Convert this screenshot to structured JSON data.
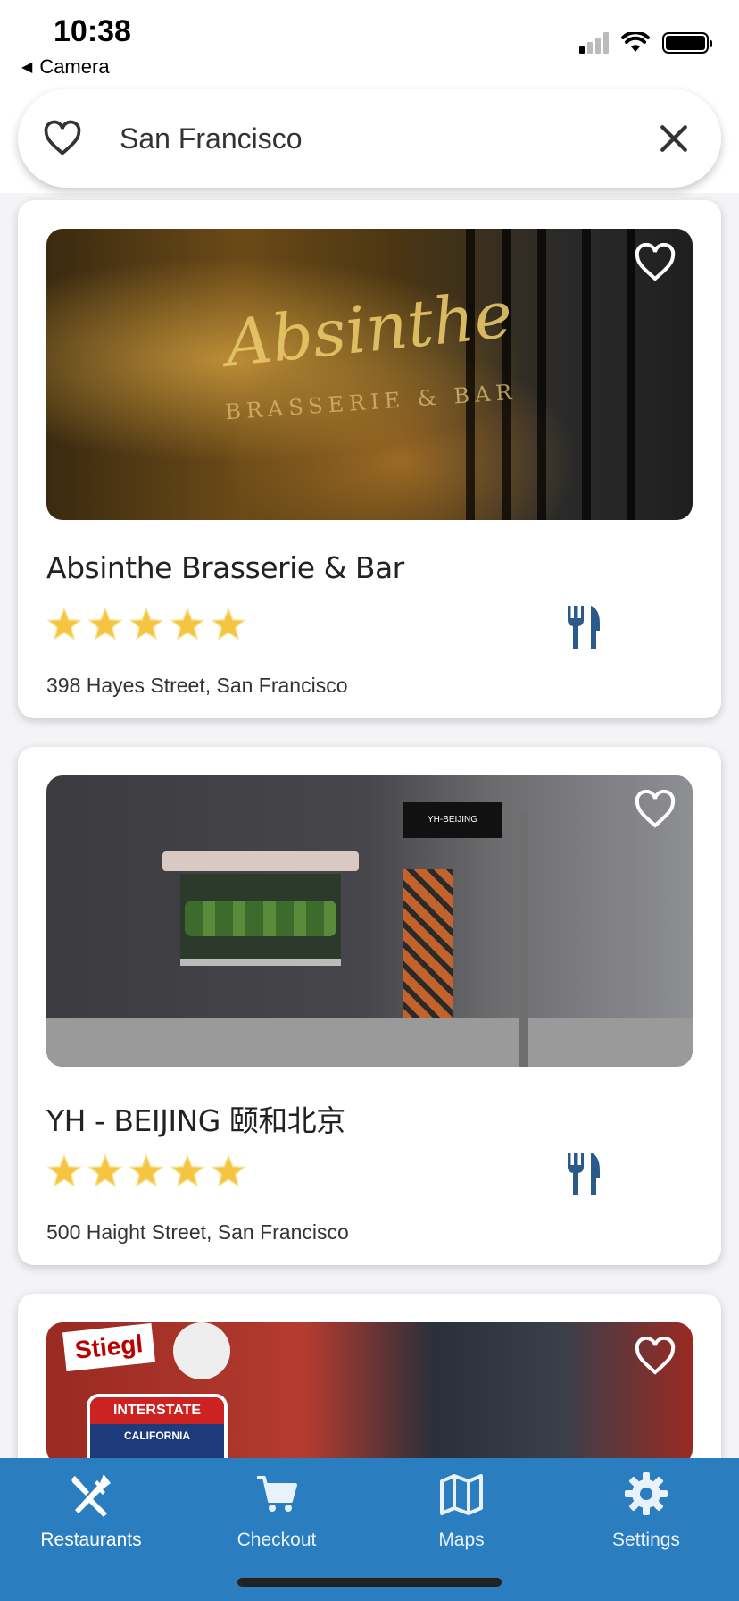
{
  "status_bar": {
    "time": "10:38",
    "back_label": "Camera"
  },
  "search": {
    "value": "San Francisco"
  },
  "restaurants": [
    {
      "name": "Absinthe Brasserie & Bar",
      "address": "398 Hayes Street, San Francisco",
      "rating": 5,
      "photo_text": "Absinthe",
      "photo_subtext": "BRASSERIE & BAR"
    },
    {
      "name": "YH - BEIJING 颐和北京",
      "address": "500 Haight Street, San Francisco",
      "rating": 5,
      "photo_text": "YH-BEIJING"
    },
    {
      "photo_logo": "Stiegl",
      "photo_shield_top": "INTERSTATE",
      "photo_shield_bottom": "CALIFORNIA"
    }
  ],
  "tabs": [
    {
      "label": "Restaurants",
      "icon": "fork-knife-icon"
    },
    {
      "label": "Checkout",
      "icon": "cart-icon"
    },
    {
      "label": "Maps",
      "icon": "map-icon"
    },
    {
      "label": "Settings",
      "icon": "gear-icon"
    }
  ],
  "colors": {
    "tab_bar": "#2a7ec0",
    "fork_icon": "#2a5a8c",
    "star": "#f5c542"
  }
}
